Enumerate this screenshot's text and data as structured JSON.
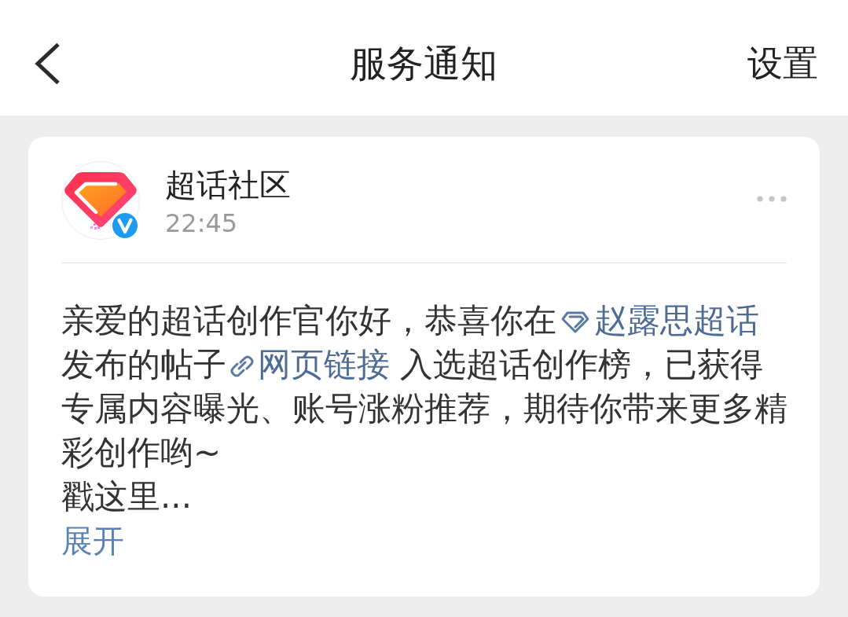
{
  "header": {
    "title": "服务通知",
    "action": "设置"
  },
  "notification": {
    "sender": "超话社区",
    "verified": true,
    "time": "22:45",
    "message": [
      {
        "kind": "text",
        "text": "亲爱的超话创作官你好，恭喜你在"
      },
      {
        "kind": "topic",
        "text": "赵露思超话"
      },
      {
        "kind": "text",
        "text": "发布的帖子"
      },
      {
        "kind": "link",
        "text": "网页链接"
      },
      {
        "kind": "text",
        "text": " 入选超话创作榜，已获得专属内容曝光、账号涨粉推荐，期待你带来更多精彩创作哟~\n戳这里..."
      }
    ],
    "expand_label": "展开"
  }
}
